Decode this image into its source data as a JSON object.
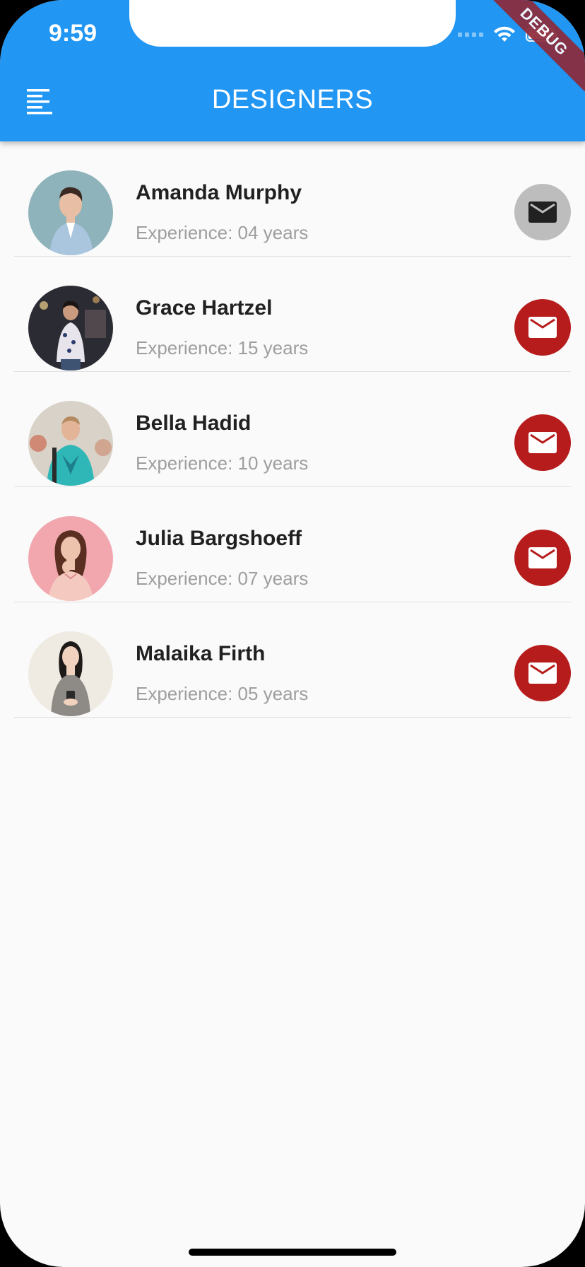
{
  "status_bar": {
    "time": "9:59"
  },
  "app_bar": {
    "title": "DESIGNERS",
    "background_color": "#2196F3",
    "menu_icon": "menu-lines-icon"
  },
  "debug_banner": {
    "label": "DEBUG"
  },
  "designers": [
    {
      "name": "Amanda Murphy",
      "experience": "Experience: 04 years",
      "mail_state": "inactive",
      "avatar_bg": "#8FB3BA"
    },
    {
      "name": "Grace Hartzel",
      "experience": "Experience: 15 years",
      "mail_state": "active",
      "avatar_bg": "#2B2B33"
    },
    {
      "name": "Bella Hadid",
      "experience": "Experience: 10 years",
      "mail_state": "active",
      "avatar_bg": "#D9D2C8"
    },
    {
      "name": "Julia Bargshoeff",
      "experience": "Experience: 07 years",
      "mail_state": "active",
      "avatar_bg": "#F2A7AF"
    },
    {
      "name": "Malaika Firth",
      "experience": "Experience: 05 years",
      "mail_state": "active",
      "avatar_bg": "#EFEAE2"
    }
  ],
  "colors": {
    "mail_active": "#B71C1C",
    "mail_inactive": "#BDBDBD",
    "name_text": "#212121",
    "experience_text": "#9E9E9E"
  },
  "icons": {
    "mail": "envelope-icon"
  }
}
